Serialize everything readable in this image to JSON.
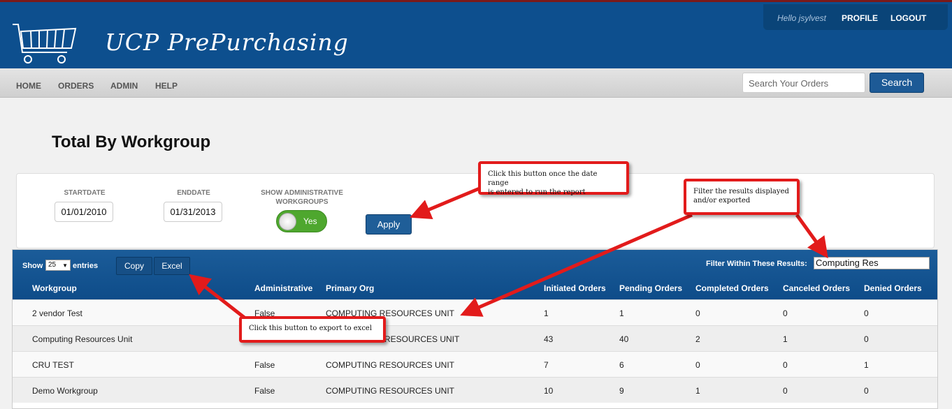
{
  "header": {
    "app_title": "UCP PrePurchasing",
    "greeting": "Hello jsylvest",
    "profile_label": "PROFILE",
    "logout_label": "LOGOUT"
  },
  "nav": {
    "items": [
      "HOME",
      "ORDERS",
      "ADMIN",
      "HELP"
    ],
    "search_placeholder": "Search Your Orders",
    "search_button": "Search"
  },
  "page": {
    "title": "Total By Workgroup"
  },
  "filters": {
    "startdate_label": "STARTDATE",
    "startdate_value": "01/01/2010",
    "enddate_label": "ENDDATE",
    "enddate_value": "01/31/2013",
    "show_admin_label_line1": "SHOW ADMINISTRATIVE",
    "show_admin_label_line2": "WORKGROUPS",
    "toggle_value": "Yes",
    "apply_button": "Apply"
  },
  "table": {
    "show_label": "Show",
    "entries_value": "25",
    "entries_label": "entries",
    "copy_button": "Copy",
    "excel_button": "Excel",
    "filter_label": "Filter Within These Results:",
    "filter_value": "Computing Res",
    "columns": [
      "Workgroup",
      "Administrative",
      "Primary Org",
      "Initiated Orders",
      "Pending Orders",
      "Completed Orders",
      "Canceled Orders",
      "Denied Orders"
    ],
    "rows": [
      [
        "2 vendor Test",
        "False",
        "COMPUTING RESOURCES UNIT",
        "1",
        "1",
        "0",
        "0",
        "0"
      ],
      [
        "Computing Resources Unit",
        "",
        "RESOURCES UNIT",
        "43",
        "40",
        "2",
        "1",
        "0"
      ],
      [
        "CRU TEST",
        "False",
        "COMPUTING RESOURCES UNIT",
        "7",
        "6",
        "0",
        "0",
        "1"
      ],
      [
        "Demo Workgroup",
        "False",
        "COMPUTING RESOURCES UNIT",
        "10",
        "9",
        "1",
        "0",
        "0"
      ]
    ]
  },
  "callouts": {
    "apply_line1": "Click this button once the date range",
    "apply_line2": "is entered to run the report",
    "filter_line1": "Filter the results displayed",
    "filter_line2": "and/or exported",
    "excel": "Click this button to export to excel"
  },
  "colors": {
    "brand_blue": "#0d4f8e",
    "callout_red": "#e21b1b",
    "toggle_green": "#4ea72e"
  }
}
